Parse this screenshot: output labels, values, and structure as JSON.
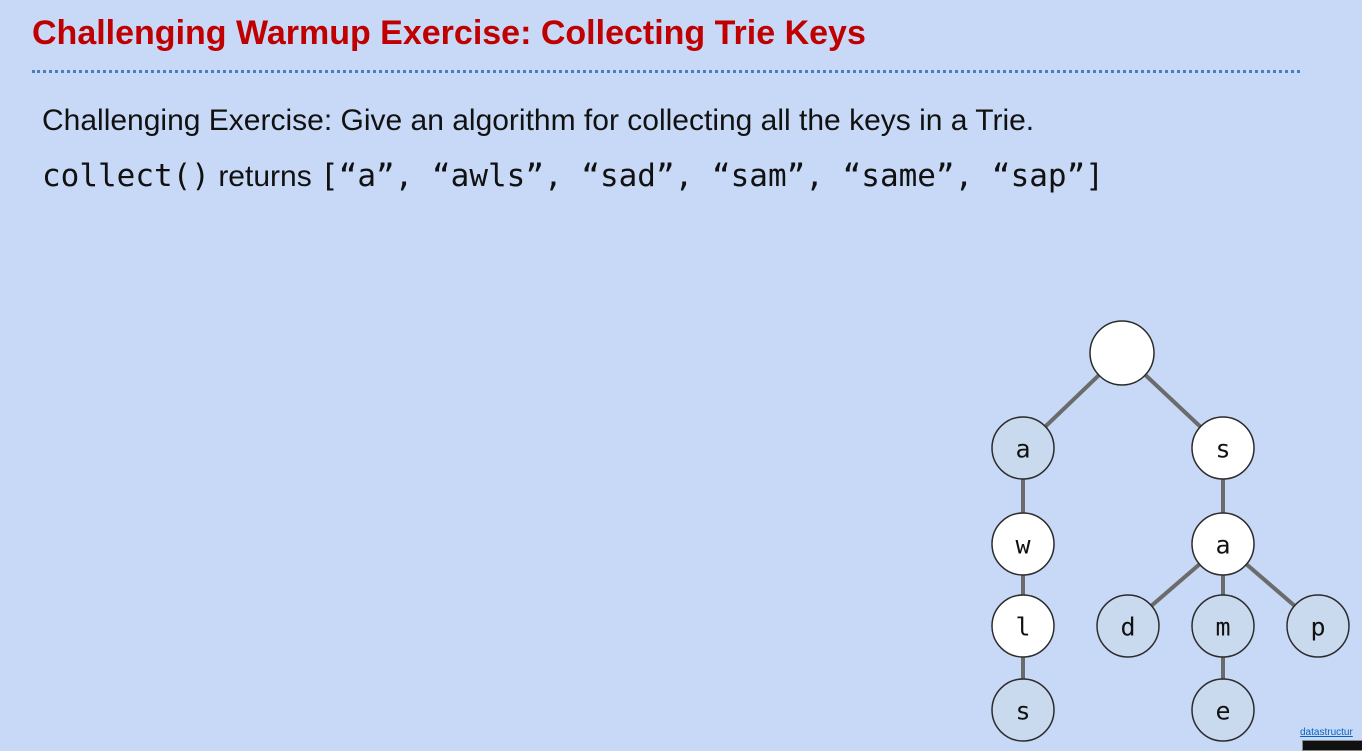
{
  "slide": {
    "title": "Challenging Warmup Exercise: Collecting Trie Keys",
    "prompt": "Challenging Exercise: Give an algorithm for collecting all the keys in a Trie.",
    "call_code": "collect()",
    "call_text": " returns ",
    "result_code": "[“a”, “awls”, “sad”, “sam”, “same”, “sap”]",
    "credit_text": "datastructur"
  },
  "colors": {
    "background": "#c7d9f6",
    "title": "#c00000",
    "key_node_fill": "#c9d9ee",
    "plain_node_fill": "#ffffff",
    "edge": "#6b6b6b"
  },
  "trie": {
    "nodes": [
      {
        "id": "root",
        "label": "",
        "is_key": false
      },
      {
        "id": "a",
        "label": "a",
        "is_key": true
      },
      {
        "id": "aw",
        "label": "w",
        "is_key": false
      },
      {
        "id": "awl",
        "label": "l",
        "is_key": false
      },
      {
        "id": "awls",
        "label": "s",
        "is_key": true
      },
      {
        "id": "s",
        "label": "s",
        "is_key": false
      },
      {
        "id": "sa",
        "label": "a",
        "is_key": false
      },
      {
        "id": "sad",
        "label": "d",
        "is_key": true
      },
      {
        "id": "sam",
        "label": "m",
        "is_key": true
      },
      {
        "id": "same",
        "label": "e",
        "is_key": true
      },
      {
        "id": "sap",
        "label": "p",
        "is_key": true
      }
    ],
    "edges": [
      [
        "root",
        "a"
      ],
      [
        "root",
        "s"
      ],
      [
        "a",
        "aw"
      ],
      [
        "aw",
        "awl"
      ],
      [
        "awl",
        "awls"
      ],
      [
        "s",
        "sa"
      ],
      [
        "sa",
        "sad"
      ],
      [
        "sa",
        "sam"
      ],
      [
        "sa",
        "sap"
      ],
      [
        "sam",
        "same"
      ]
    ]
  }
}
